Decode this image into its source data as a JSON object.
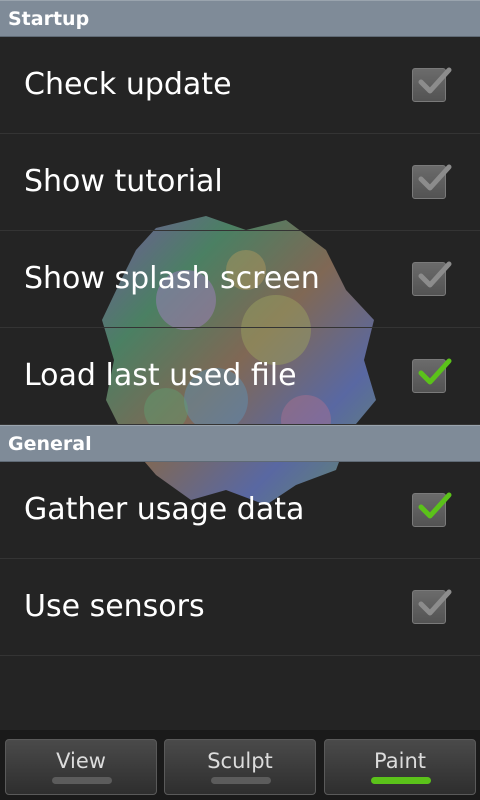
{
  "sections": [
    {
      "title": "Startup",
      "items": [
        {
          "label": "Check update",
          "checked": true,
          "enabled": false
        },
        {
          "label": "Show tutorial",
          "checked": true,
          "enabled": false
        },
        {
          "label": "Show splash screen",
          "checked": true,
          "enabled": false
        },
        {
          "label": "Load last used file",
          "checked": true,
          "enabled": true
        }
      ]
    },
    {
      "title": "General",
      "items": [
        {
          "label": "Gather usage data",
          "checked": true,
          "enabled": true
        },
        {
          "label": "Use sensors",
          "checked": true,
          "enabled": false
        }
      ]
    }
  ],
  "bottom_bar": {
    "tabs": [
      {
        "label": "View",
        "active": false
      },
      {
        "label": "Sculpt",
        "active": false
      },
      {
        "label": "Paint",
        "active": true
      }
    ]
  },
  "colors": {
    "background": "#242424",
    "section_header": "#7f8b98",
    "check_active": "#5bc21a",
    "check_disabled": "#8c8c8c"
  }
}
